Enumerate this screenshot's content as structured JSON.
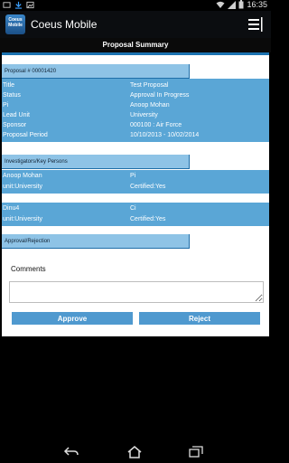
{
  "status_bar": {
    "time": "16:35",
    "icons": [
      "screenshot-icon",
      "download-icon",
      "image-icon",
      "wifi-icon",
      "signal-icon",
      "battery-icon"
    ]
  },
  "app": {
    "title": "Coeus Mobile",
    "logo_text": "Coeus Mobile"
  },
  "page": {
    "title": "Proposal Summary"
  },
  "proposal": {
    "header": "Proposal # 00001420",
    "rows": [
      {
        "label": "Title",
        "value": "Test Proposal"
      },
      {
        "label": "Status",
        "value": "Approval In Progress"
      },
      {
        "label": "Pi",
        "value": "Anoop Mohan"
      },
      {
        "label": "Lead Unit",
        "value": "University"
      },
      {
        "label": "Sponsor",
        "value": "000100 : Air Force"
      },
      {
        "label": "Proposal Period",
        "value": "10/10/2013 - 10/02/2014"
      }
    ]
  },
  "investigators": {
    "header": "Investigators/Key Persons",
    "groups": [
      [
        {
          "label": "Anoop Mohan",
          "value": "Pi"
        },
        {
          "label": "unit:University",
          "value": "Certified:Yes"
        }
      ],
      [
        {
          "label": "Dinu4",
          "value": "Ci"
        },
        {
          "label": "unit:University",
          "value": "Certified:Yes"
        }
      ]
    ]
  },
  "approval": {
    "header": "Approval/Rejection",
    "comments_label": "Comments",
    "comments_value": "",
    "approve_label": "Approve",
    "reject_label": "Reject"
  },
  "colors": {
    "accent": "#1b72b0",
    "band": "#5aa6d6",
    "tab": "#8ec3e6",
    "button": "#4f99cf"
  }
}
